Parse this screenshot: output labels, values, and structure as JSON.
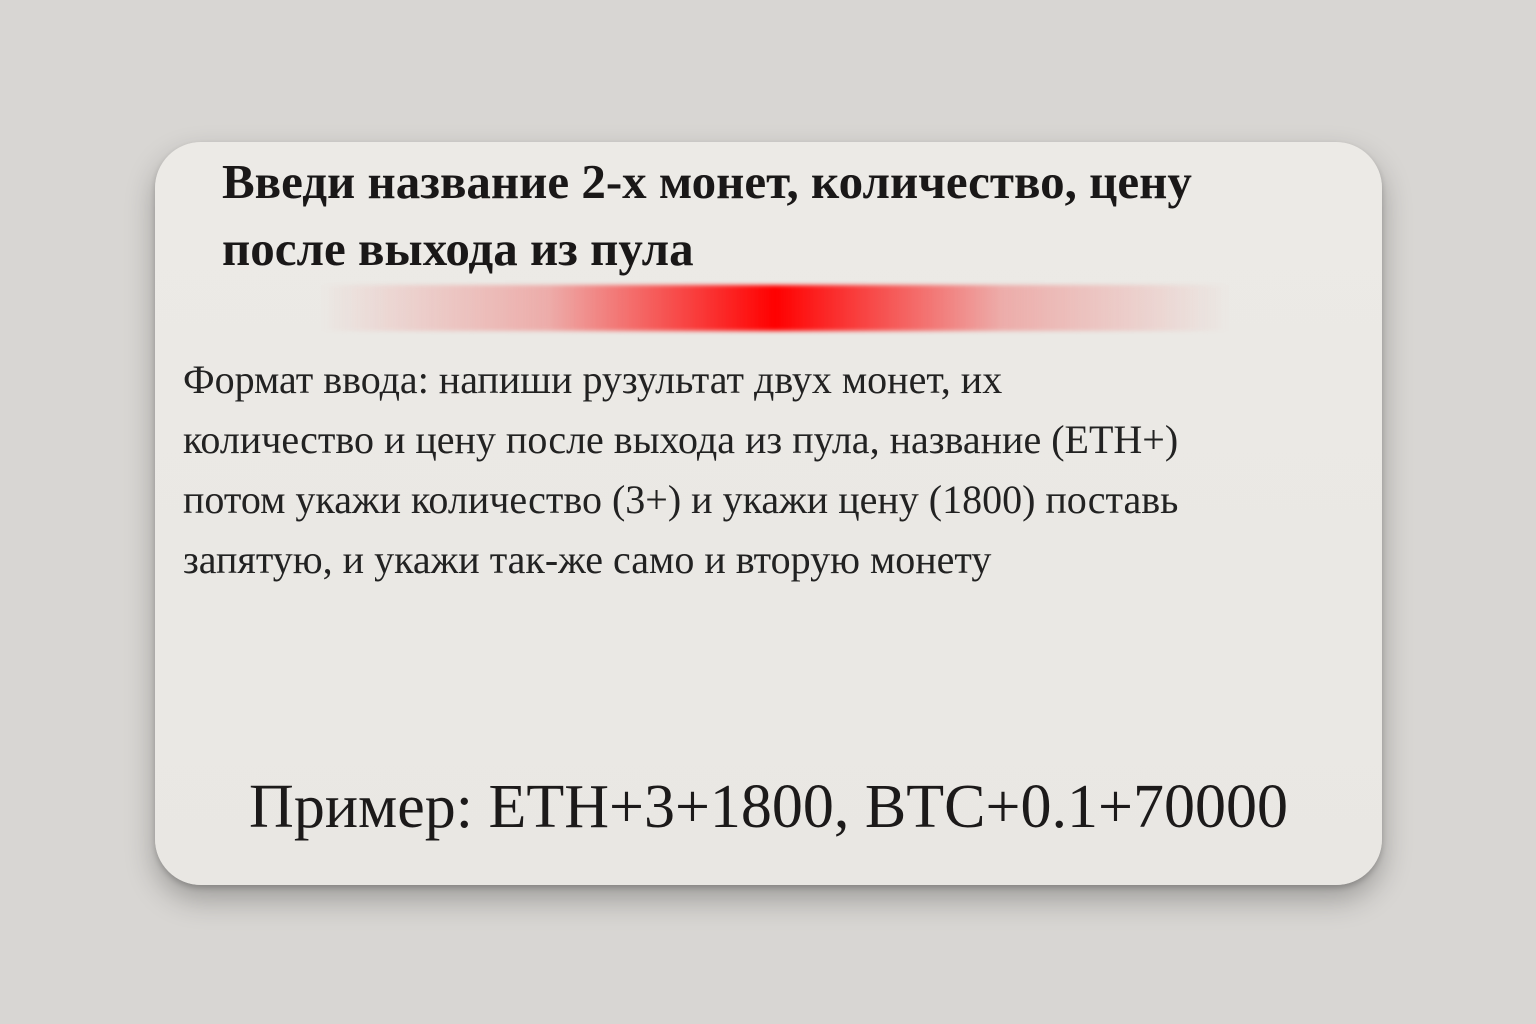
{
  "card": {
    "title_lines": [
      "Введи название 2-х монет, количество, цену",
      "после выхода из пула"
    ],
    "accent_color": "#ff0000",
    "body_lines": [
      "Формат ввода: напиши рузультат двух монет, их",
      "количество и цену после выхода из пула, название (ETH+)",
      "потом укажи количество (3+) и укажи цену (1800) поставь",
      "запятую, и укажи так-же само и вторую монету"
    ],
    "example": "Пример: ETH+3+1800, BTC+0.1+70000"
  }
}
